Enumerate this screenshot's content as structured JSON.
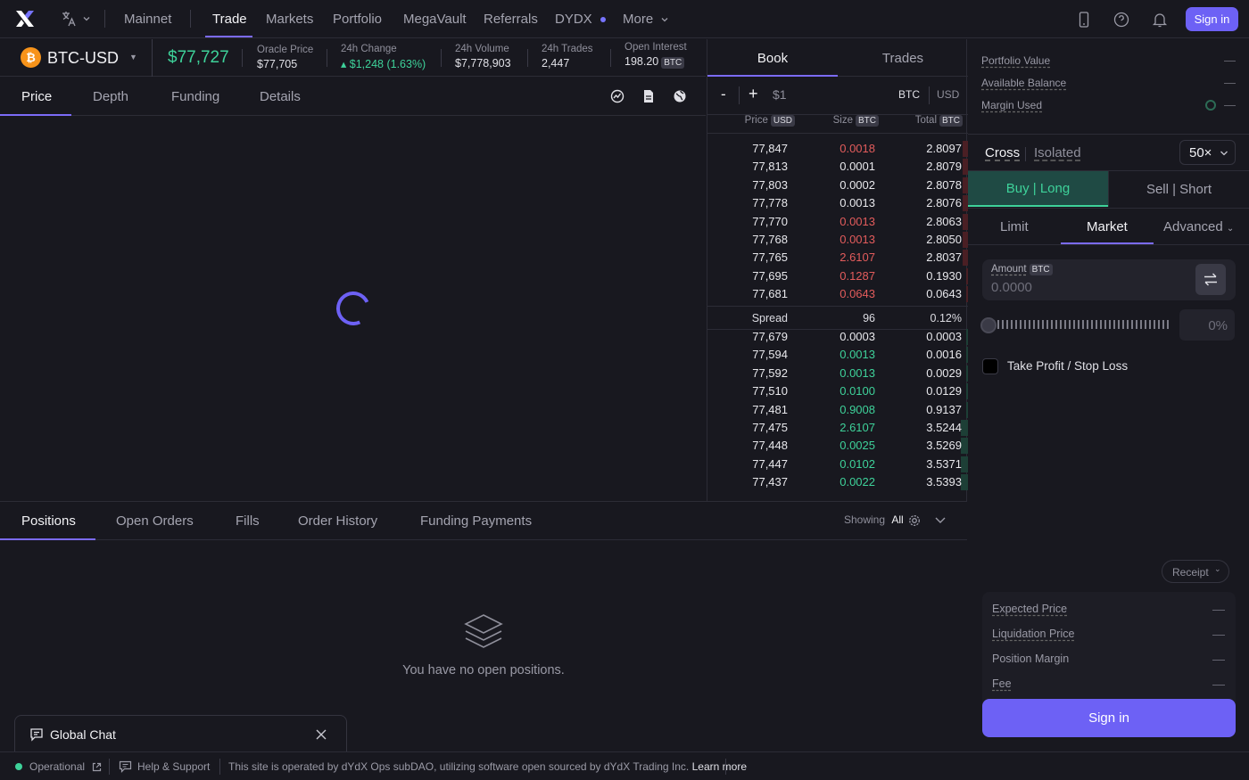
{
  "nav": {
    "network": "Mainnet",
    "items": [
      "Trade",
      "Markets",
      "Portfolio",
      "MegaVault",
      "Referrals",
      "DYDX",
      "More"
    ],
    "sign_in": "Sign in"
  },
  "market": {
    "pair": "BTC-USD",
    "price": "$77,727",
    "stats": [
      {
        "label": "Oracle Price",
        "value": "$77,705"
      },
      {
        "label": "24h Change",
        "value": "▴ $1,248 (1.63%)"
      },
      {
        "label": "24h Volume",
        "value": "$7,778,903"
      },
      {
        "label": "24h Trades",
        "value": "2,447"
      },
      {
        "label": "Open Interest",
        "value": "198.20",
        "unit": "BTC"
      }
    ]
  },
  "chart_tabs": [
    "Price",
    "Depth",
    "Funding",
    "Details"
  ],
  "orderbook": {
    "tabs": [
      "Book",
      "Trades"
    ],
    "controls": {
      "minus": "-",
      "plus": "+",
      "amount": "$1",
      "unit_a": "BTC",
      "unit_b": "USD"
    },
    "columns": {
      "price": "Price",
      "price_unit": "USD",
      "size": "Size",
      "size_unit": "BTC",
      "total": "Total",
      "total_unit": "BTC"
    },
    "asks": [
      {
        "price": "77,847",
        "size": "0.0018",
        "total": "2.8097",
        "color": "red"
      },
      {
        "price": "77,813",
        "size": "0.0001",
        "total": "2.8079",
        "color": "white"
      },
      {
        "price": "77,803",
        "size": "0.0002",
        "total": "2.8078",
        "color": "white"
      },
      {
        "price": "77,778",
        "size": "0.0013",
        "total": "2.8076",
        "color": "white"
      },
      {
        "price": "77,770",
        "size": "0.0013",
        "total": "2.8063",
        "color": "red"
      },
      {
        "price": "77,768",
        "size": "0.0013",
        "total": "2.8050",
        "color": "red"
      },
      {
        "price": "77,765",
        "size": "2.6107",
        "total": "2.8037",
        "color": "red"
      },
      {
        "price": "77,695",
        "size": "0.1287",
        "total": "0.1930",
        "color": "red"
      },
      {
        "price": "77,681",
        "size": "0.0643",
        "total": "0.0643",
        "color": "red"
      }
    ],
    "spread": {
      "label": "Spread",
      "value": "96",
      "pct": "0.12%"
    },
    "bids": [
      {
        "price": "77,679",
        "size": "0.0003",
        "total": "0.0003",
        "color": "white"
      },
      {
        "price": "77,594",
        "size": "0.0013",
        "total": "0.0016",
        "color": "green"
      },
      {
        "price": "77,592",
        "size": "0.0013",
        "total": "0.0029",
        "color": "green"
      },
      {
        "price": "77,510",
        "size": "0.0100",
        "total": "0.0129",
        "color": "green"
      },
      {
        "price": "77,481",
        "size": "0.9008",
        "total": "0.9137",
        "color": "green"
      },
      {
        "price": "77,475",
        "size": "2.6107",
        "total": "3.5244",
        "color": "green"
      },
      {
        "price": "77,448",
        "size": "0.0025",
        "total": "3.5269",
        "color": "green"
      },
      {
        "price": "77,447",
        "size": "0.0102",
        "total": "3.5371",
        "color": "green"
      },
      {
        "price": "77,437",
        "size": "0.0022",
        "total": "3.5393",
        "color": "green"
      }
    ]
  },
  "bottom": {
    "tabs": [
      "Positions",
      "Open Orders",
      "Fills",
      "Order History",
      "Funding Payments"
    ],
    "showing_label": "Showing",
    "showing_value": "All",
    "empty_text": "You have no open positions."
  },
  "chat": {
    "title": "Global Chat"
  },
  "account": {
    "rows": [
      {
        "label": "Portfolio Value",
        "value": "—"
      },
      {
        "label": "Available Balance",
        "value": "—"
      },
      {
        "label": "Margin Used",
        "value": "—"
      }
    ]
  },
  "trade": {
    "margin_modes": [
      "Cross",
      "Isolated"
    ],
    "leverage": "50×",
    "sides": [
      "Buy | Long",
      "Sell | Short"
    ],
    "order_types": [
      "Limit",
      "Market",
      "Advanced"
    ],
    "amount_label": "Amount",
    "amount_unit": "BTC",
    "amount_placeholder": "0.0000",
    "percent": "0%",
    "tpsl": "Take Profit / Stop Loss",
    "receipt": "Receipt",
    "receipt_rows": [
      {
        "label": "Expected Price",
        "value": "—"
      },
      {
        "label": "Liquidation Price",
        "value": "—"
      },
      {
        "label": "Position Margin",
        "value": "—"
      },
      {
        "label": "Fee",
        "value": "—"
      }
    ],
    "sign_in": "Sign in"
  },
  "status": {
    "operational": "Operational",
    "help": "Help & Support",
    "notice": "This site is operated by dYdX Ops subDAO, utilizing software open sourced by dYdX Trading Inc.",
    "learn_more": "Learn more"
  },
  "colors": {
    "accent": "#6d61f5",
    "green": "#3ed29a",
    "red": "#e35c5c",
    "bg": "#18181f"
  }
}
